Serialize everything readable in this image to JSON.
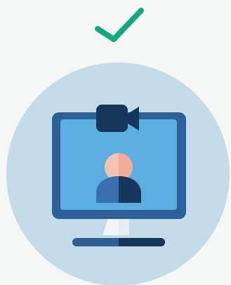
{
  "status": {
    "icon": "checkmark-icon",
    "color": "#13a97f"
  },
  "illustration": {
    "icon": "webcam-monitor-user-icon",
    "circle_color": "#c4dce8",
    "monitor_frame_color": "#2e5f96",
    "screen_color": "#5aaee0",
    "camera_color": "#17365c",
    "avatar_head_color": "#f7c3b1",
    "avatar_body_color": "#3c6fae",
    "stand_color": "#f3f4f5",
    "base_color": "#2e5f96"
  }
}
